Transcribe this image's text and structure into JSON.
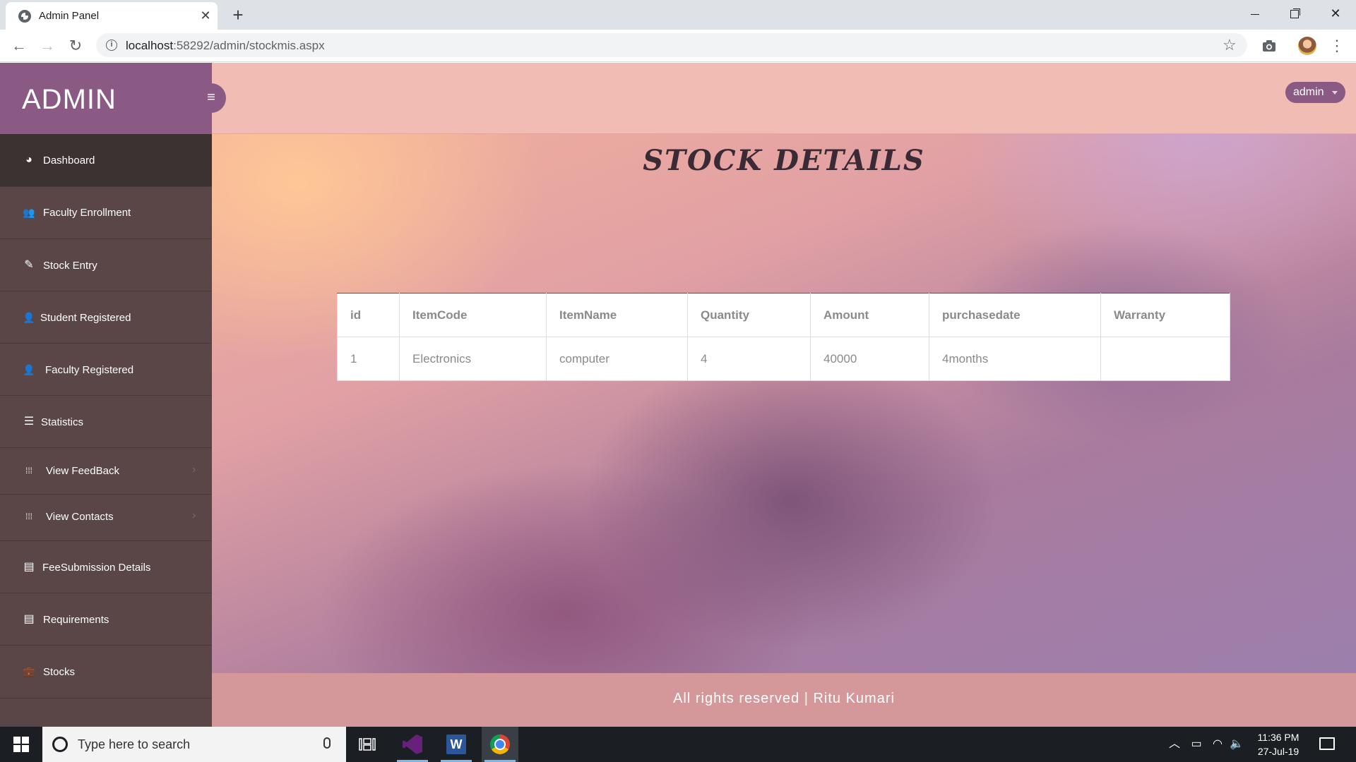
{
  "browser": {
    "tab_title": "Admin Panel",
    "tab_close": "✕",
    "new_tab": "+",
    "url_host": "localhost",
    "url_path": ":58292/admin/stockmis.aspx"
  },
  "sidebar": {
    "brand": "ADMIN",
    "items": [
      {
        "label": "Dashboard",
        "icon": "dashboard-icon",
        "glyph": "◕"
      },
      {
        "label": "Faculty Enrollment",
        "icon": "users-icon",
        "glyph": "👥"
      },
      {
        "label": "Stock Entry",
        "icon": "edit-icon",
        "glyph": "✎"
      },
      {
        "label": "Student Registered",
        "icon": "user-icon",
        "glyph": "👤"
      },
      {
        "label": "Faculty Registered",
        "icon": "user-plus-icon",
        "glyph": "👤"
      },
      {
        "label": "Statistics",
        "icon": "bars-icon",
        "glyph": "☰"
      },
      {
        "label": "View FeedBack",
        "icon": "grid-icon",
        "glyph": "⁞⁞⁞"
      },
      {
        "label": "View Contacts",
        "icon": "grid-icon",
        "glyph": "⁞⁞⁞"
      },
      {
        "label": "FeeSubmission Details",
        "icon": "book-icon",
        "glyph": "▤"
      },
      {
        "label": "Requirements",
        "icon": "list-icon",
        "glyph": "▤"
      },
      {
        "label": "Stocks",
        "icon": "briefcase-icon",
        "glyph": "💼"
      }
    ]
  },
  "header": {
    "user": "admin"
  },
  "main": {
    "title": "STOCK DETAILS",
    "table": {
      "columns": [
        "id",
        "ItemCode",
        "ItemName",
        "Quantity",
        "Amount",
        "purchasedate",
        "Warranty"
      ],
      "rows": [
        [
          "1",
          "Electronics",
          "computer",
          "4",
          "40000",
          "4months",
          ""
        ]
      ]
    }
  },
  "footer": {
    "text": "All rights reserved | Ritu Kumari"
  },
  "taskbar": {
    "search_placeholder": "Type here to search",
    "time": "11:36 PM",
    "date": "27-Jul-19"
  }
}
